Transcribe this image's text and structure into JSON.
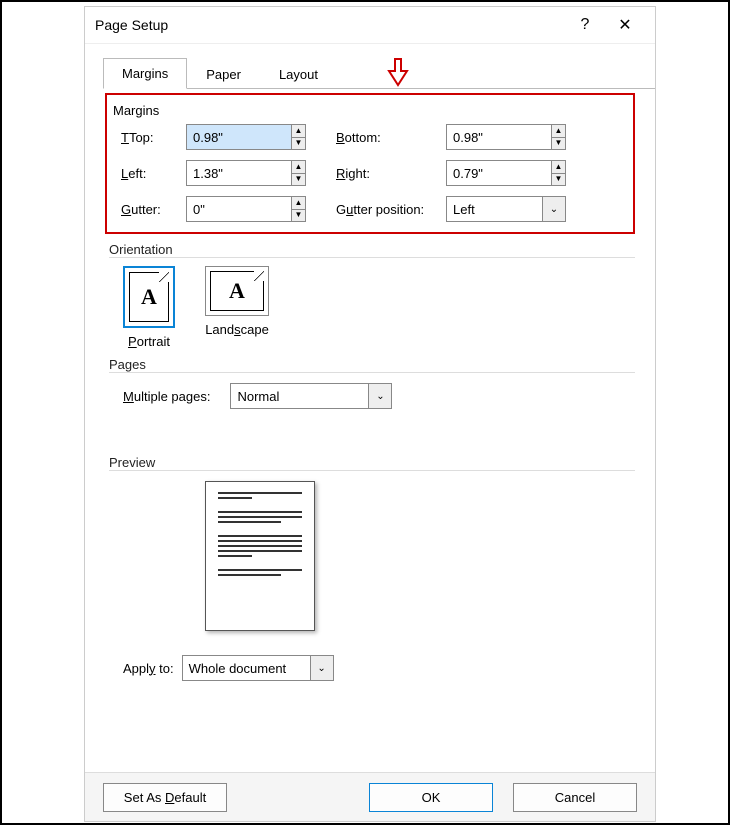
{
  "title": "Page Setup",
  "tabs": {
    "margins": "Margins",
    "paper": "Paper",
    "layout": "Layout"
  },
  "section": {
    "margins": "Margins",
    "orientation": "Orientation",
    "pages": "Pages",
    "preview": "Preview"
  },
  "margins": {
    "top_label": "Top:",
    "top_mn": "T",
    "top": "0.98\"",
    "bottom_label": "ottom:",
    "bottom_mn": "B",
    "bottom": "0.98\"",
    "left_label": "eft:",
    "left_mn": "L",
    "left": "1.38\"",
    "right_label": "ight:",
    "right_mn": "R",
    "right": "0.79\"",
    "gutter_label": "utter:",
    "gutter_mn": "G",
    "gutter": "0\"",
    "gutterpos_label": "tter position:",
    "gutterpos_pre": "G",
    "gutterpos_mn": "u",
    "gutterpos": "Left"
  },
  "orientation": {
    "portrait": "Portrait",
    "portrait_mn": "P",
    "landscape": "Landscape",
    "landscape_mn": "s",
    "land_pre": "Land",
    "land_post": "cape",
    "glyph": "A"
  },
  "pages": {
    "label": "ultiple pages:",
    "mn": "M",
    "value": "Normal"
  },
  "apply": {
    "label": "Appl",
    "mn": "y",
    "label2": " to:",
    "value": "Whole document"
  },
  "buttons": {
    "default": "Set As ",
    "default_mn": "D",
    "default2": "efault",
    "ok": "OK",
    "cancel": "Cancel"
  },
  "icons": {
    "up": "▲",
    "down": "▼",
    "chev": "⌄",
    "help": "?",
    "close": "✕"
  }
}
